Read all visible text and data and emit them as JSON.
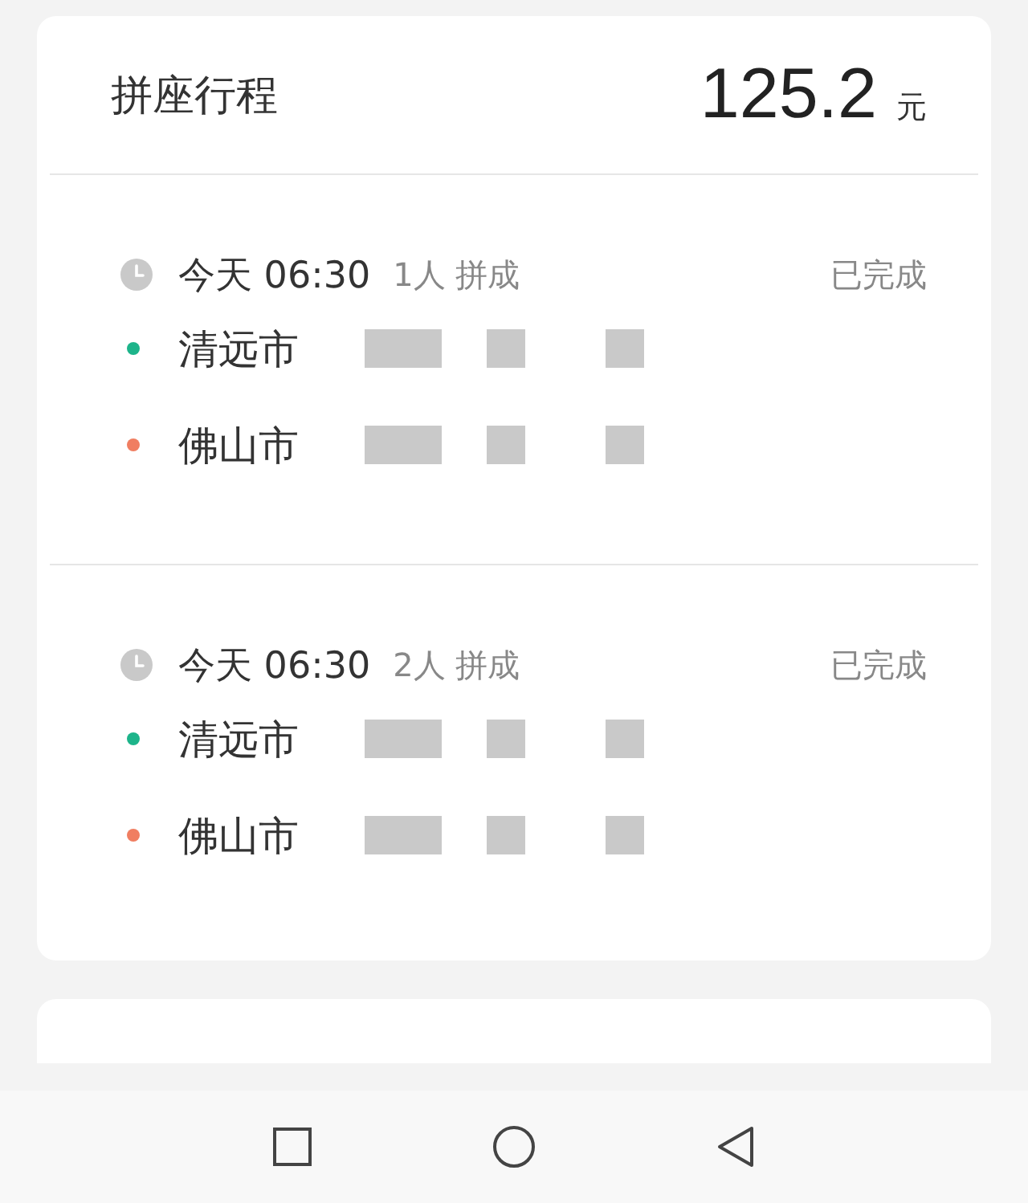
{
  "header": {
    "title": "拼座行程",
    "amount": "125.2",
    "currency": "元"
  },
  "trips": [
    {
      "time": "今天 06:30",
      "passengers": "1人 拼成",
      "status": "已完成",
      "stops": [
        {
          "name": "清远市",
          "color": "#1db48a"
        },
        {
          "name": "佛山市",
          "color": "#f07e61"
        }
      ]
    },
    {
      "time": "今天 06:30",
      "passengers": "2人 拼成",
      "status": "已完成",
      "stops": [
        {
          "name": "清远市",
          "color": "#1db48a"
        },
        {
          "name": "佛山市",
          "color": "#f07e61"
        }
      ]
    }
  ]
}
